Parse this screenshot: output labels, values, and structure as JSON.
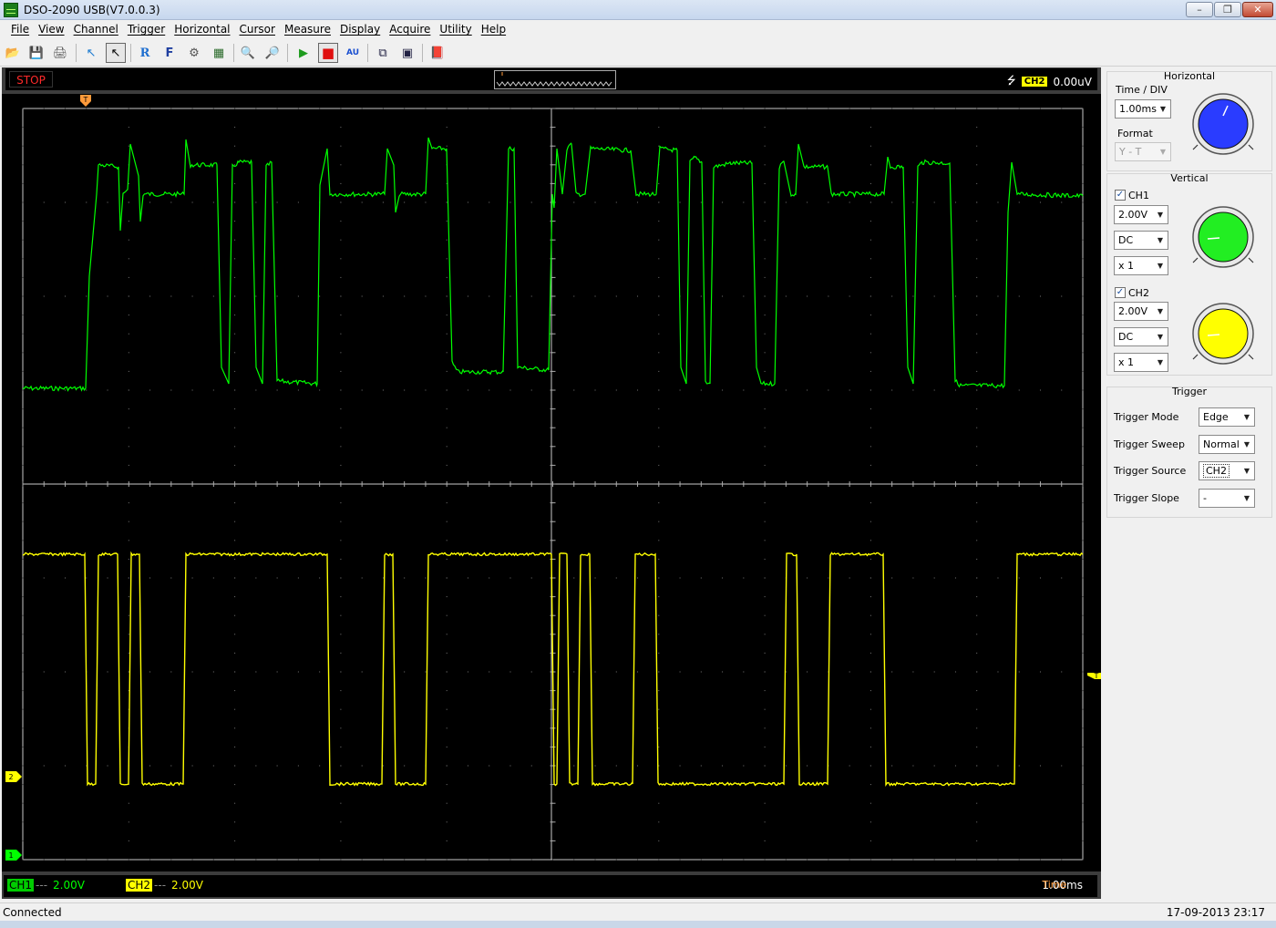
{
  "window": {
    "title": "DSO-2090 USB(V7.0.0.3)",
    "min_glyph": "–",
    "max_glyph": "❐",
    "close_glyph": "✕"
  },
  "menu": [
    "File",
    "View",
    "Channel",
    "Trigger",
    "Horizontal",
    "Cursor",
    "Measure",
    "Display",
    "Acquire",
    "Utility",
    "Help"
  ],
  "toolbar": {
    "icons": [
      "open-icon",
      "save-icon",
      "print-icon",
      "pointer-zoom-icon",
      "pointer-icon",
      "reference-icon",
      "fft-icon",
      "math-icon",
      "persist-icon",
      "zoom-in-icon",
      "zoom-out-icon",
      "run-icon",
      "stop-icon",
      "auto-icon",
      "screen-icon",
      "window-icon",
      "book-icon"
    ],
    "glyphs": [
      "📂",
      "💾",
      "🖨",
      "↖",
      "↖",
      "R",
      "F",
      "⚙",
      "▦",
      "🔍",
      "🔎",
      "▶",
      "■",
      "AU",
      "⧉",
      "▣",
      "📕"
    ]
  },
  "scope": {
    "run_state": "STOP",
    "trigger_channel": "CH2",
    "trigger_level": "0.00uV",
    "ch1_tag": "CH1",
    "ch1_scale": "2.00V",
    "ch2_tag": "CH2",
    "ch2_scale": "2.00V",
    "time_label": "Time",
    "time_value": "1.00ms",
    "colors": {
      "ch1": "#00ff00",
      "ch2": "#ffff00",
      "trigger": "#ffaa00"
    },
    "marker_glyphs": {
      "trigger_pos": "T",
      "trigger_level": "T",
      "ch1": "1",
      "ch2": "2"
    }
  },
  "panel": {
    "horizontal": {
      "title": "Horizontal",
      "time_div_label": "Time / DIV",
      "time_div_value": "1.00ms",
      "format_label": "Format",
      "format_value": "Y - T"
    },
    "vertical": {
      "title": "Vertical",
      "ch1": {
        "label": "CH1",
        "checked": true,
        "volts": "2.00V",
        "coupling": "DC",
        "probe": "x 1"
      },
      "ch2": {
        "label": "CH2",
        "checked": true,
        "volts": "2.00V",
        "coupling": "DC",
        "probe": "x 1"
      }
    },
    "trigger": {
      "title": "Trigger",
      "mode_label": "Trigger Mode",
      "mode_value": "Edge",
      "sweep_label": "Trigger Sweep",
      "sweep_value": "Normal",
      "source_label": "Trigger Source",
      "source_value": "CH2",
      "slope_label": "Trigger Slope",
      "slope_value": "-"
    }
  },
  "statusbar": {
    "left": "Connected",
    "right": "17-09-2013  23:17"
  }
}
